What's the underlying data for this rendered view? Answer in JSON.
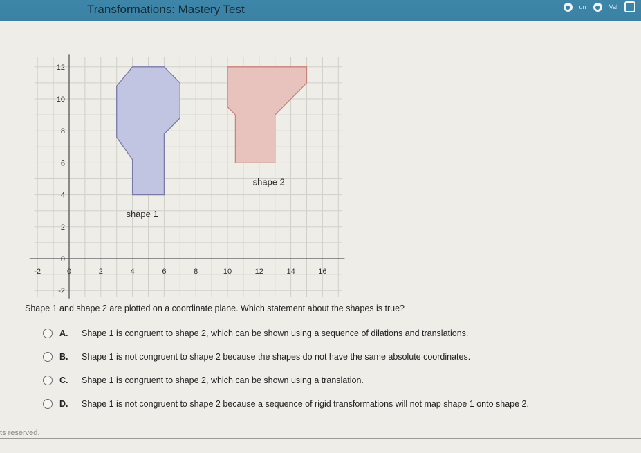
{
  "header": {
    "title": "Transformations: Mastery Test"
  },
  "tray": {
    "text1": "un",
    "text2": "Val"
  },
  "graph": {
    "x_ticks": [
      "-2",
      "0",
      "2",
      "4",
      "6",
      "8",
      "10",
      "12",
      "14",
      "16"
    ],
    "y_ticks": [
      "12",
      "10",
      "8",
      "6",
      "4",
      "2",
      "0",
      "-2"
    ],
    "shape1_label": "shape 1",
    "shape2_label": "shape 2",
    "shape1_fill": "#c2c5e2",
    "shape2_fill": "#e8c3bd"
  },
  "question": "Shape 1 and shape 2 are plotted on a coordinate plane. Which statement about the shapes is true?",
  "options": [
    {
      "letter": "A.",
      "text": "Shape 1 is congruent to shape 2, which can be shown using a sequence of dilations and translations."
    },
    {
      "letter": "B.",
      "text": "Shape 1 is not congruent to shape 2 because the shapes do not have the same absolute coordinates."
    },
    {
      "letter": "C.",
      "text": "Shape 1 is congruent to shape 2, which can be shown using a translation."
    },
    {
      "letter": "D.",
      "text": "Shape 1 is not congruent to shape 2 because a sequence of rigid transformations will not map shape 1 onto shape 2."
    }
  ],
  "footer": "ts reserved."
}
